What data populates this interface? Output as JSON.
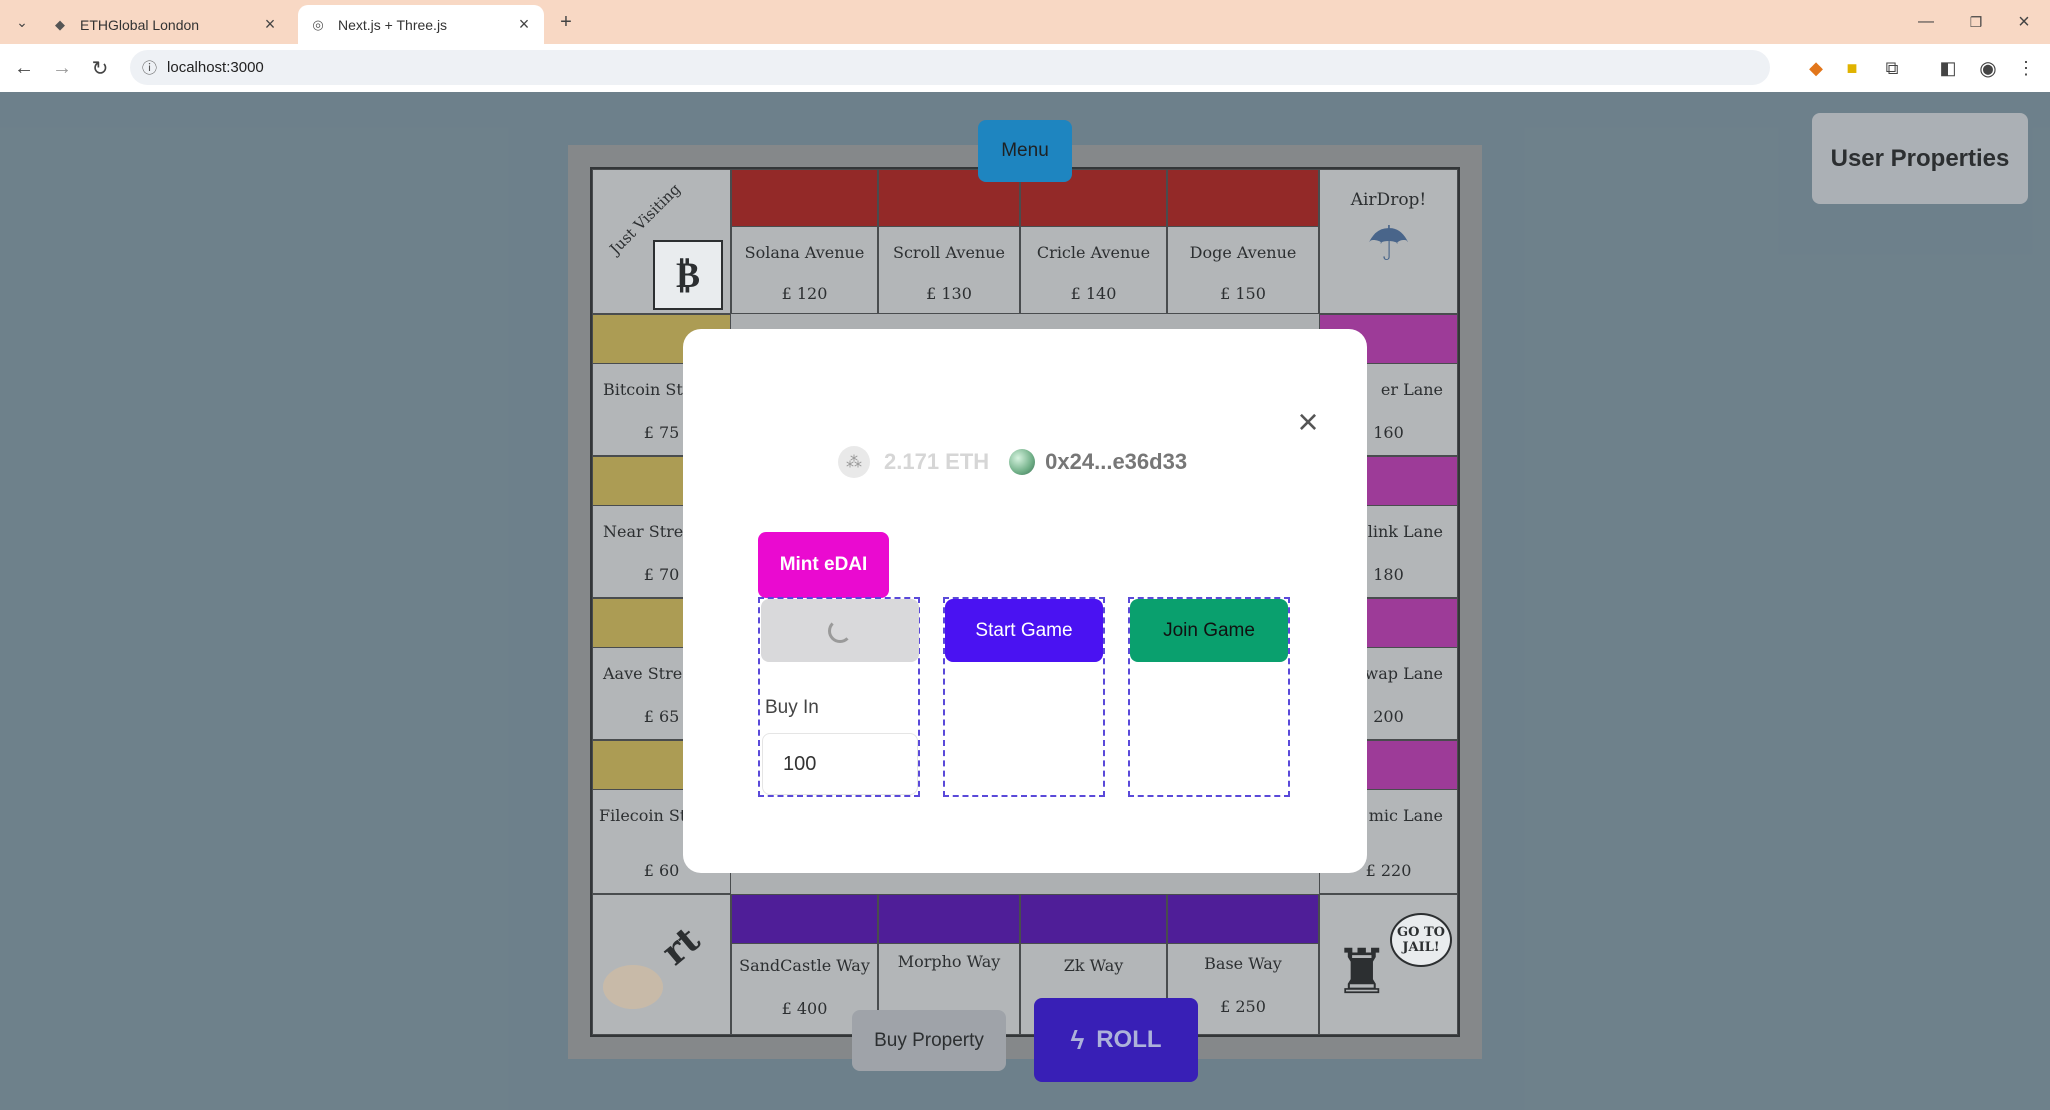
{
  "browser": {
    "tabs": [
      {
        "title": "ETHGlobal London",
        "icon": "ethglobal-icon",
        "active": false
      },
      {
        "title": "Next.js + Three.js",
        "icon": "globe-icon",
        "active": true
      }
    ],
    "url": "localhost:3000"
  },
  "page": {
    "menu_label": "Menu",
    "user_properties_label": "User Properties",
    "buy_property_label": "Buy Property",
    "roll_label": "ROLL"
  },
  "board": {
    "corner_top_left": "Just Visiting",
    "corner_top_right": "AirDrop!",
    "corner_bottom_right": "GO TO JAIL!",
    "corner_bottom_left": "rt",
    "top_row": [
      {
        "name": "Solana Avenue",
        "price": "£ 120",
        "color": "#9b1b17"
      },
      {
        "name": "Scroll Avenue",
        "price": "£ 130",
        "color": "#9b1b17"
      },
      {
        "name": "Cricle Avenue",
        "price": "£ 140",
        "color": "#9b1b17"
      },
      {
        "name": "Doge Avenue",
        "price": "£ 150",
        "color": "#9b1b17"
      }
    ],
    "left_col": [
      {
        "name": "Bitcoin St",
        "price": "£ 75",
        "color": "#b8a14a"
      },
      {
        "name": "Near Stre",
        "price": "£ 70",
        "color": "#b8a14a"
      },
      {
        "name": "Aave Stre",
        "price": "£ 65",
        "color": "#b8a14a"
      },
      {
        "name": "Filecoin St",
        "price": "£ 60",
        "color": "#b8a14a"
      }
    ],
    "right_col": [
      {
        "name": "er Lane",
        "price": "160",
        "color": "#a6309a"
      },
      {
        "name": "link Lane",
        "price": "180",
        "color": "#a6309a"
      },
      {
        "name": "wap Lane",
        "price": "200",
        "color": "#a6309a"
      },
      {
        "name": "mic Lane",
        "price": "£ 220",
        "color": "#a6309a"
      }
    ],
    "bottom_row": [
      {
        "name": "SandCastle Way",
        "price": "£ 400",
        "color": "#4a0d9a"
      },
      {
        "name": "Morpho Way",
        "price": "",
        "color": "#4a0d9a"
      },
      {
        "name": "Zk Way",
        "price": "",
        "color": "#4a0d9a"
      },
      {
        "name": "Base Way",
        "price": "£ 250",
        "color": "#4a0d9a"
      }
    ]
  },
  "modal": {
    "balance": "2.171 ETH",
    "address": "0x24...e36d33",
    "mint_label": "Mint eDAI",
    "start_game_label": "Start Game",
    "join_game_label": "Join Game",
    "buy_in_label": "Buy In",
    "buy_in_value": "100",
    "close_icon": "close-icon"
  }
}
